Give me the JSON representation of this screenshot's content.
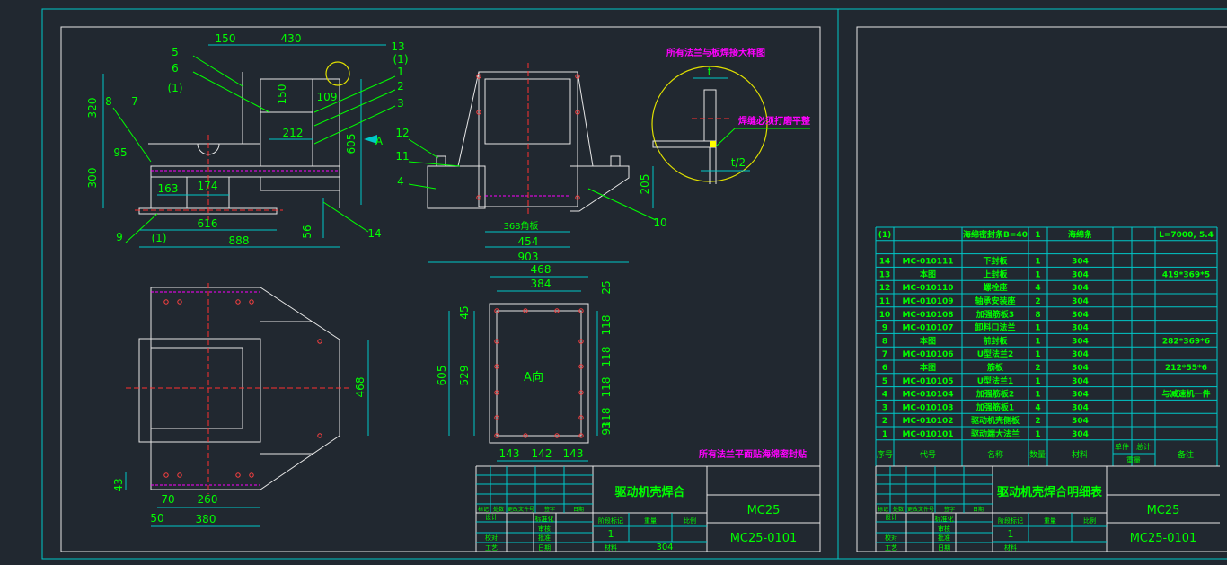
{
  "drawing": {
    "front_view": {
      "labels": [
        "150",
        "430",
        "13",
        "(1)",
        "1",
        "2",
        "3",
        "5",
        "6",
        "(1)",
        "8",
        "7",
        "320",
        "150",
        "109",
        "212",
        "605",
        "A",
        "95",
        "300",
        "163",
        "174",
        "616",
        "888",
        "56",
        "14",
        "9",
        "(1)"
      ]
    },
    "side_view": {
      "labels": [
        "12",
        "11",
        "4",
        "10",
        "205",
        "368角板",
        "454",
        "903"
      ]
    },
    "detail": {
      "title": "所有法兰与板焊接大样图",
      "t": "t",
      "note": "焊缝必须打磨平整",
      "half_t": "t/2"
    },
    "plan_view": {
      "labels": [
        "468",
        "43",
        "70",
        "260",
        "50",
        "380"
      ]
    },
    "a_view": {
      "labels": [
        "468",
        "384",
        "25",
        "45",
        "118",
        "118",
        "118",
        "118",
        "93",
        "605",
        "529",
        "A向",
        "143",
        "142",
        "143"
      ]
    },
    "note": "所有法兰平面贴海绵密封贴"
  },
  "title_block": {
    "title": "驱动机壳焊合",
    "project": "MC25",
    "drawing_no": "MC25-0101",
    "rev_headers": [
      "标记",
      "处数",
      "更改文件号",
      "签字",
      "日期"
    ],
    "left_labels": [
      "设计",
      "校对",
      "工艺"
    ],
    "mid_labels": [
      "标准化",
      "审核",
      "批准",
      "日期"
    ],
    "stage_headers": [
      "阶段标记",
      "重量",
      "比例"
    ],
    "stage_value": "1",
    "material_label": "材料",
    "material": "304"
  },
  "bom_title_block": {
    "title": "驱动机壳焊合明细表",
    "project": "MC25",
    "drawing_no": "MC25-0101",
    "rev_headers": [
      "标记",
      "处数",
      "更改文件号",
      "签字",
      "日期"
    ],
    "left_labels": [
      "设计",
      "校对",
      "工艺"
    ],
    "mid_labels": [
      "标准化",
      "审核",
      "批准",
      "日期"
    ],
    "stage_headers": [
      "阶段标记",
      "重量",
      "比例"
    ],
    "stage_value": "1",
    "material_label": "材料"
  },
  "bom": {
    "headers": {
      "seq": "序号",
      "code": "代号",
      "name": "名称",
      "qty": "数量",
      "material": "材料",
      "unit": "单件",
      "total": "总计",
      "weight": "重量",
      "remark": "备注"
    },
    "rows": [
      [
        "(1)",
        "",
        "海绵密封条B=40",
        "1",
        "海绵条",
        "",
        "",
        "L=7000, 5.4"
      ],
      [
        "",
        "",
        "",
        "",
        "",
        "",
        "",
        ""
      ],
      [
        "14",
        "MC-010111",
        "下封板",
        "1",
        "304",
        "",
        "",
        ""
      ],
      [
        "13",
        "本图",
        "上封板",
        "1",
        "304",
        "",
        "",
        "419*369*5"
      ],
      [
        "12",
        "MC-010110",
        "螺栓座",
        "4",
        "304",
        "",
        "",
        ""
      ],
      [
        "11",
        "MC-010109",
        "轴承安装座",
        "2",
        "304",
        "",
        "",
        ""
      ],
      [
        "10",
        "MC-010108",
        "加强筋板3",
        "8",
        "304",
        "",
        "",
        ""
      ],
      [
        "9",
        "MC-010107",
        "卸料口法兰",
        "1",
        "304",
        "",
        "",
        ""
      ],
      [
        "8",
        "本图",
        "前封板",
        "1",
        "304",
        "",
        "",
        "282*369*6"
      ],
      [
        "7",
        "MC-010106",
        "U型法兰2",
        "1",
        "304",
        "",
        "",
        ""
      ],
      [
        "6",
        "本图",
        "筋板",
        "2",
        "304",
        "",
        "",
        "212*55*6"
      ],
      [
        "5",
        "MC-010105",
        "U型法兰1",
        "1",
        "304",
        "",
        "",
        ""
      ],
      [
        "4",
        "MC-010104",
        "加强筋板2",
        "1",
        "304",
        "",
        "",
        "与减速机一件"
      ],
      [
        "3",
        "MC-010103",
        "加强筋板1",
        "4",
        "304",
        "",
        "",
        ""
      ],
      [
        "2",
        "MC-010102",
        "驱动机壳侧板",
        "2",
        "304",
        "",
        "",
        ""
      ],
      [
        "1",
        "MC-010101",
        "驱动端大法兰",
        "1",
        "304",
        "",
        "",
        ""
      ]
    ]
  },
  "colors": {
    "background": "#212830",
    "outline": "#e6e6e6",
    "dimension": "#00c8c8",
    "text": "#00ff00",
    "note": "#ff00ff",
    "centerline": "#ff3030",
    "detail_circle": "#e0e000"
  }
}
